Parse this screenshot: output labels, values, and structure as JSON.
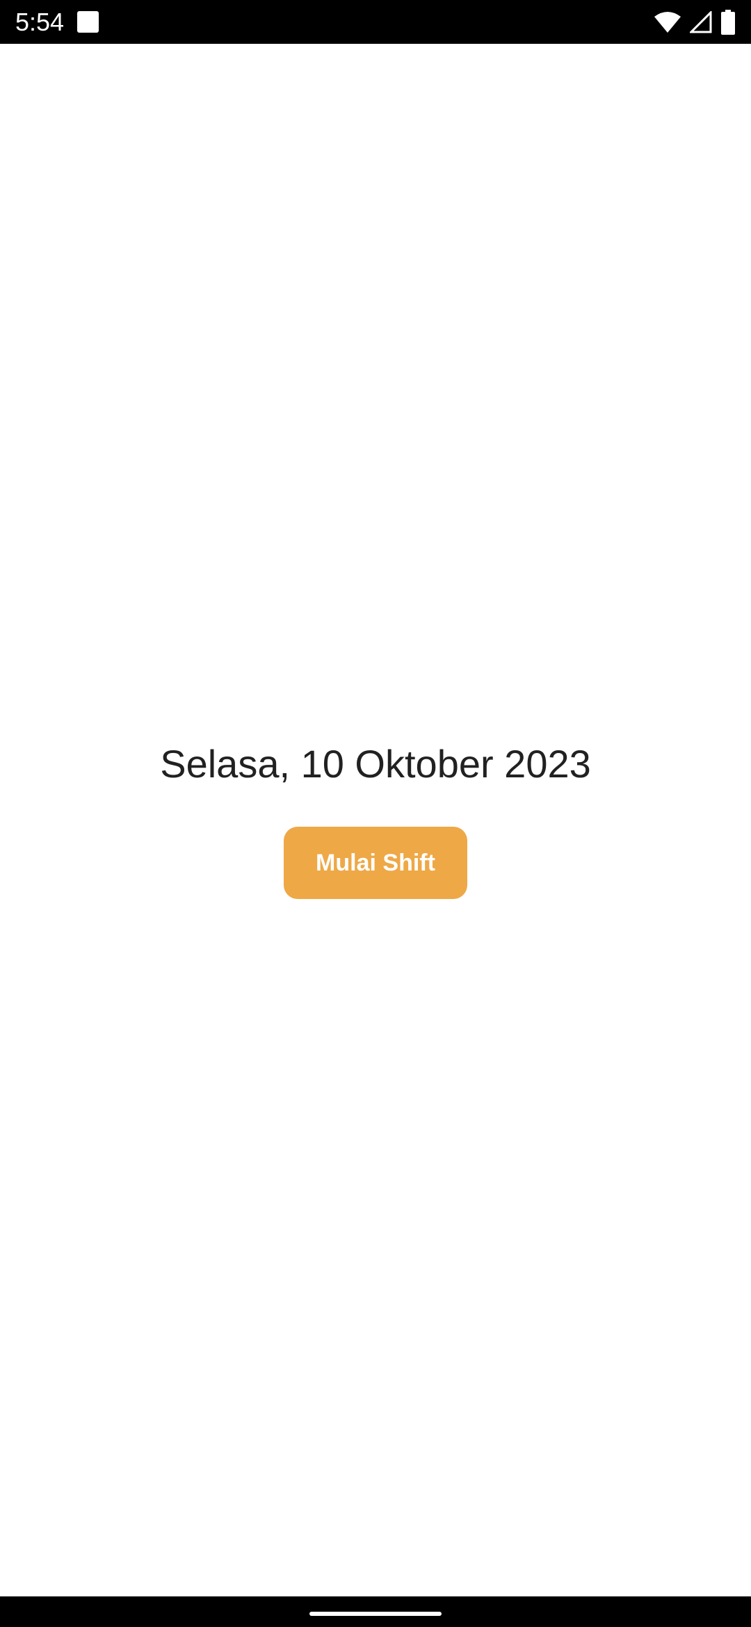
{
  "status_bar": {
    "time": "5:54",
    "icons": [
      "notification-square-icon",
      "wifi-icon",
      "signal-icon",
      "battery-icon"
    ]
  },
  "main": {
    "date_label": "Selasa, 10 Oktober 2023",
    "start_shift_label": "Mulai Shift"
  },
  "colors": {
    "accent": "#eea846",
    "text": "#212121",
    "background": "#ffffff",
    "system_bars": "#000000"
  }
}
